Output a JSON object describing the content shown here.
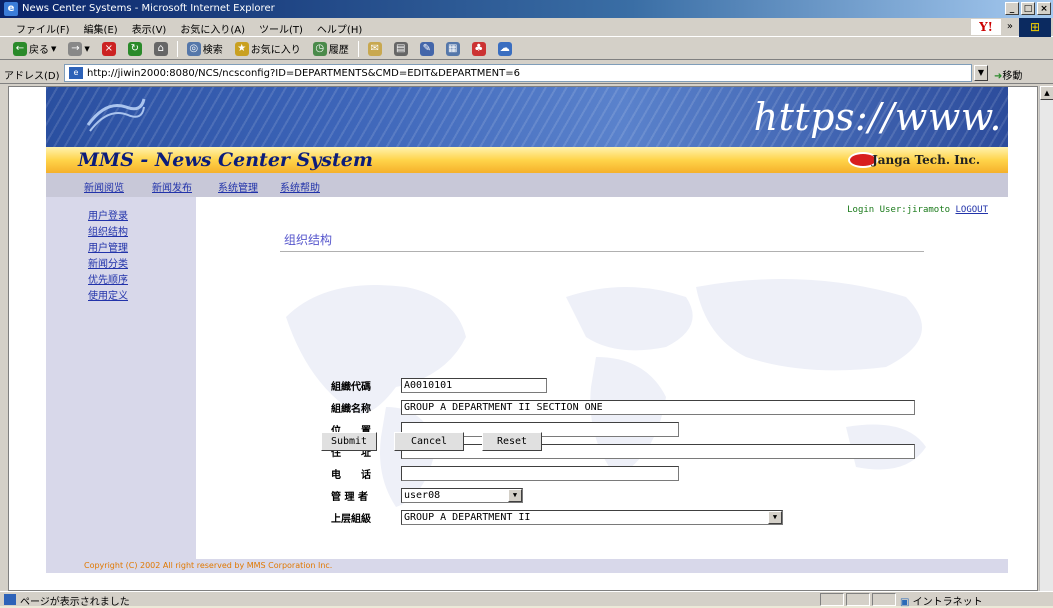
{
  "window": {
    "title": "News Center Systems - Microsoft Internet Explorer",
    "controls": [
      "_",
      "□",
      "×"
    ]
  },
  "menu": {
    "items": [
      "ファイル(F)",
      "編集(E)",
      "表示(V)",
      "お気に入り(A)",
      "ツール(T)",
      "ヘルプ(H)"
    ],
    "chevron": "»"
  },
  "toolbar": {
    "back": "戻る",
    "search": "検索",
    "favorites": "お気に入り",
    "history": "履歴"
  },
  "address": {
    "label": "アドレス(D)",
    "url": "http://jiwin2000:8080/NCS/ncsconfig?ID=DEPARTMENTS&CMD=EDIT&DEPARTMENT=6",
    "go": "移動"
  },
  "banner": {
    "text": "https://www."
  },
  "header": {
    "title": "MMS - News Center System",
    "company": "Janga Tech. Inc."
  },
  "nav": {
    "items": [
      "新闻阅览",
      "新闻发布",
      "系统管理",
      "系统帮助"
    ]
  },
  "sidebar": {
    "items": [
      "用户登录",
      "组织结构",
      "用户管理",
      "新闻分类",
      "优先顺序",
      "使用定义"
    ]
  },
  "login": {
    "prefix": "Login User:jiramoto",
    "logout": "LOGOUT"
  },
  "section": {
    "title": "组织结构"
  },
  "form": {
    "code": {
      "label": "組織代碼",
      "value": "A0010101"
    },
    "name": {
      "label": "組織名称",
      "value": "GROUP A DEPARTMENT II SECTION ONE"
    },
    "position": {
      "label": "位　　置",
      "value": ""
    },
    "address": {
      "label": "住　　址",
      "value": ""
    },
    "phone": {
      "label": "电　　话",
      "value": ""
    },
    "manager": {
      "label": "管 理 者",
      "value": "user08"
    },
    "parent": {
      "label": "上层組級",
      "value": "GROUP A DEPARTMENT II"
    }
  },
  "buttons": {
    "submit": "Submit",
    "cancel": "Cancel",
    "reset": "Reset"
  },
  "footer": {
    "text": "Copyright (C) 2002 All right reserved by MMS Corporation Inc."
  },
  "status": {
    "message": "ページが表示されました",
    "zone": "イントラネット"
  }
}
